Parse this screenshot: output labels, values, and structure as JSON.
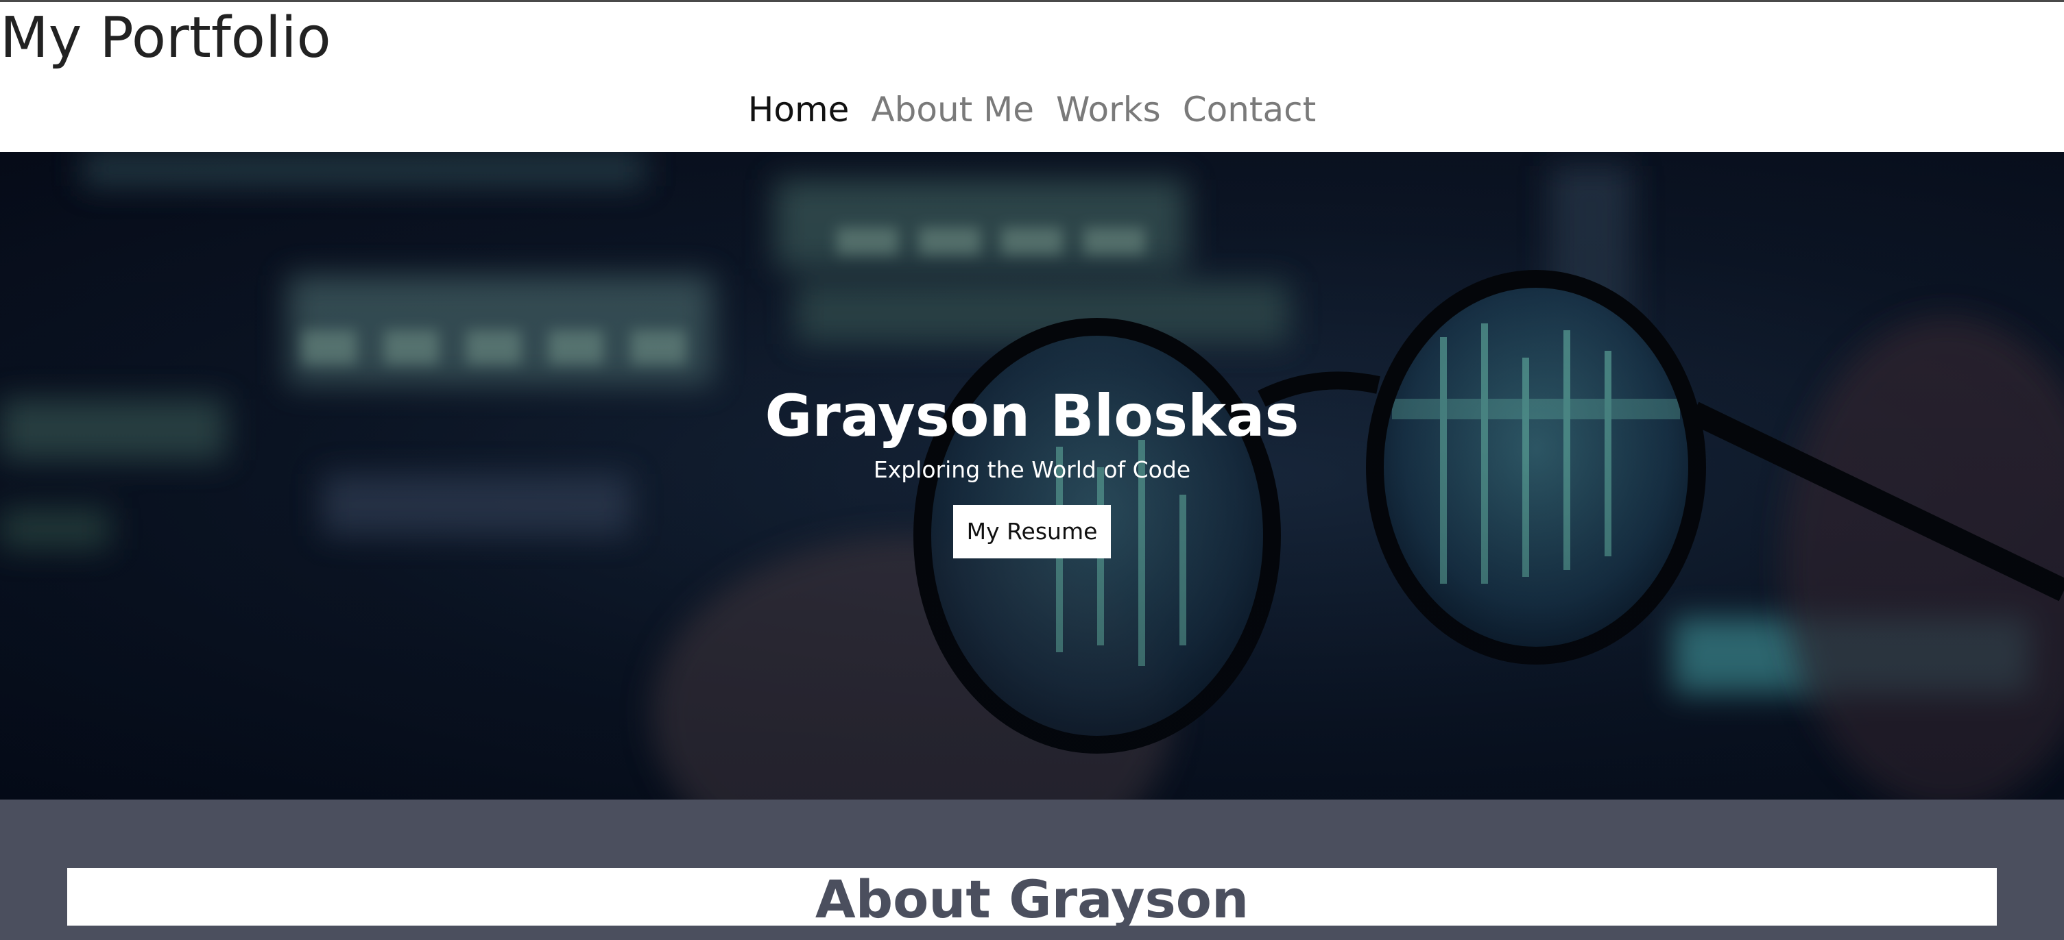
{
  "site": {
    "title": "My Portfolio"
  },
  "nav": {
    "items": [
      {
        "label": "Home",
        "active": true
      },
      {
        "label": "About Me",
        "active": false
      },
      {
        "label": "Works",
        "active": false
      },
      {
        "label": "Contact",
        "active": false
      }
    ]
  },
  "hero": {
    "name": "Grayson Bloskas",
    "tagline": "Exploring the World of Code",
    "button_label": "My Resume",
    "background_image": "glasses-reflecting-code-image"
  },
  "about": {
    "heading": "About Grayson"
  },
  "colors": {
    "nav_active": "#111111",
    "nav_inactive": "#7a7a7a",
    "about_bg": "#4b4f5e",
    "hero_bg": "#0d1626",
    "code_green": "#6fe0c0"
  }
}
